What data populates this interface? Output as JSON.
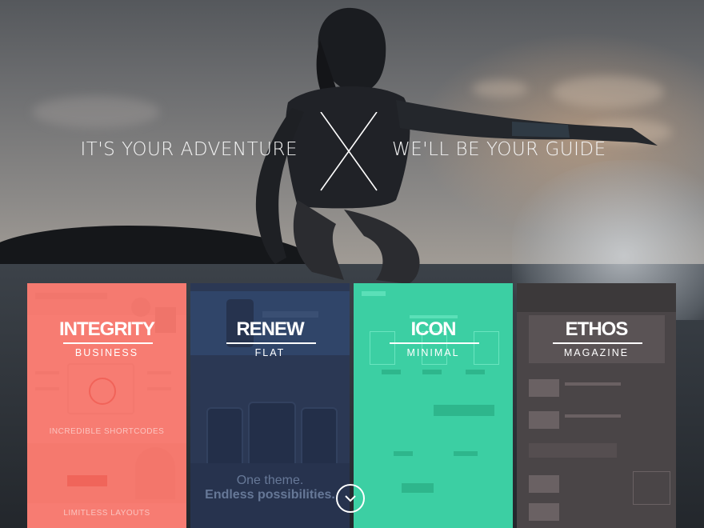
{
  "hero": {
    "tagline_left": "IT'S YOUR ADVENTURE",
    "tagline_right": "WE'LL BE YOUR GUIDE"
  },
  "themes": [
    {
      "name": "INTEGRITY",
      "style": "BUSINESS",
      "tint": "#f66a5e",
      "preview_texts": [
        "INCREDIBLE SHORTCODES",
        "LIMITLESS LAYOUTS"
      ]
    },
    {
      "name": "RENEW",
      "style": "FLAT",
      "tint": "#2f3c57",
      "preview_texts": [
        "One theme.",
        "Endless possibilities."
      ]
    },
    {
      "name": "ICON",
      "style": "MINIMAL",
      "tint": "#3ccfa3",
      "preview_texts": []
    },
    {
      "name": "ETHOS",
      "style": "MAGAZINE",
      "tint": "#474243",
      "preview_texts": []
    }
  ],
  "scroll_down_icon": "chevron-down-circle-icon"
}
